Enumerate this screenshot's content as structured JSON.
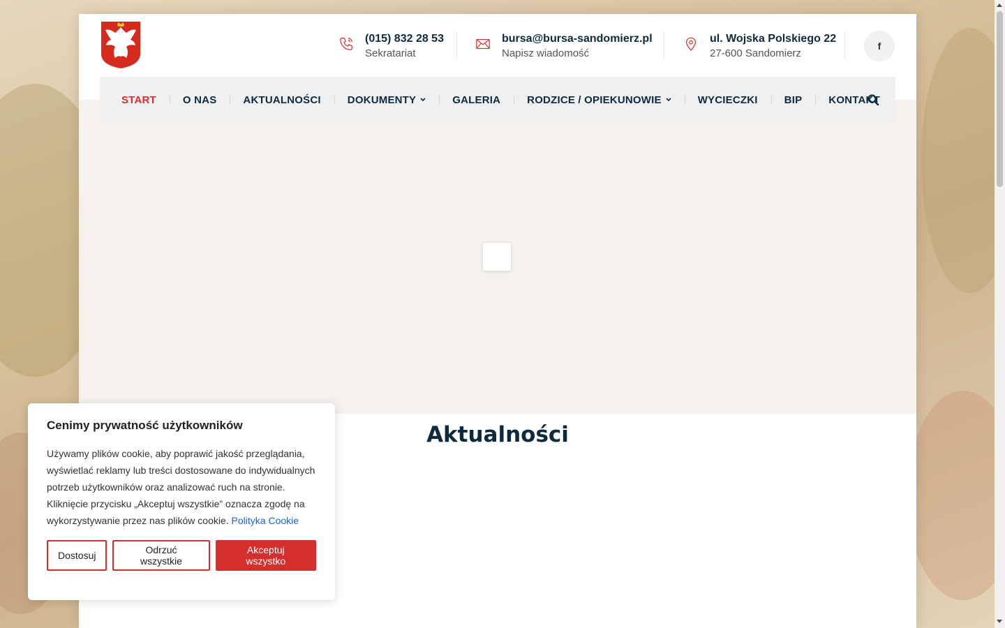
{
  "header": {
    "phone": {
      "title": "(015) 832 28 53",
      "subtitle": "Sekratariat",
      "icon": "phone-icon"
    },
    "email": {
      "title": "bursa@bursa-sandomierz.pl",
      "subtitle": "Napisz wiadomość",
      "icon": "envelope-icon"
    },
    "address": {
      "title": "ul. Wojska Polskiego 22",
      "subtitle": "27-600 Sandomierz",
      "icon": "map-pin-icon"
    },
    "social": {
      "facebook_label": "f"
    }
  },
  "nav": {
    "items": [
      {
        "label": "START",
        "active": true
      },
      {
        "label": "O NAS"
      },
      {
        "label": "AKTUALNOŚCI"
      },
      {
        "label": "DOKUMENTY",
        "dropdown": true
      },
      {
        "label": "GALERIA"
      },
      {
        "label": "RODZICE / OPIEKUNOWIE",
        "dropdown": true
      },
      {
        "label": "WYCIECZKI"
      },
      {
        "label": "BIP"
      },
      {
        "label": "KONTAKT"
      }
    ]
  },
  "main": {
    "section_title": "Aktualności"
  },
  "cookie": {
    "title": "Cenimy prywatność użytkowników",
    "text": "Używamy plików cookie, aby poprawić jakość przeglądania, wyświetlać reklamy lub treści dostosowane do indywidualnych potrzeb użytkowników oraz analizować ruch na stronie. Kliknięcie przycisku „Akceptuj wszystkie” oznacza zgodę na wykorzystywanie przez nas plików cookie.",
    "link": "Polityka Cookie",
    "customize": "Dostosuj",
    "reject": "Odrzuć wszystkie",
    "accept": "Akceptuj wszystko"
  },
  "colors": {
    "accent": "#d62d2d",
    "navy": "#0e2a3e",
    "link": "#1863dc"
  }
}
